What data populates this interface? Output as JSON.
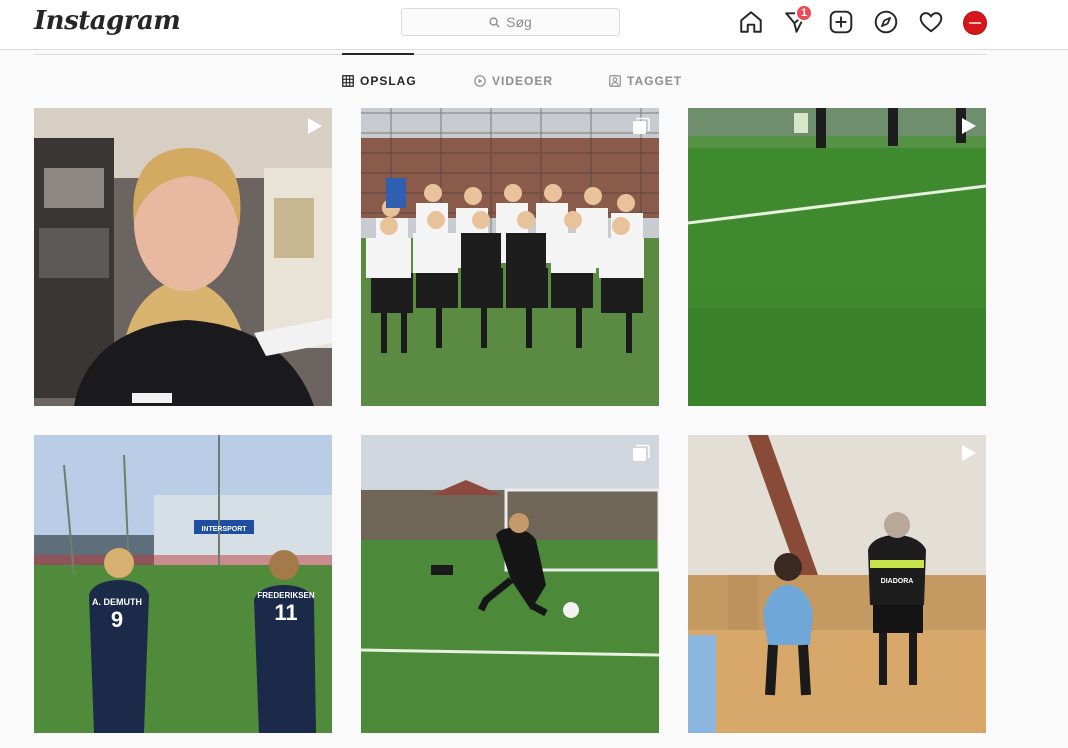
{
  "header": {
    "logo_text": "Instagram",
    "search_placeholder": "Søg",
    "notification_count": "1",
    "icons": [
      "home-icon",
      "direct-message-icon",
      "new-post-icon",
      "explore-icon",
      "activity-heart-icon",
      "profile-avatar"
    ]
  },
  "tabs": [
    {
      "label": "OPSLAG",
      "icon": "grid-icon",
      "active": true
    },
    {
      "label": "VIDEOER",
      "icon": "play-circle-icon",
      "active": false
    },
    {
      "label": "TAGGET",
      "icon": "tagged-user-icon",
      "active": false
    }
  ],
  "posts": [
    {
      "type": "video",
      "indicator": "play-icon"
    },
    {
      "type": "carousel",
      "indicator": "carousel-icon"
    },
    {
      "type": "video",
      "indicator": "play-icon"
    },
    {
      "type": "photo",
      "indicator": "",
      "text_in_image": [
        "A. DEMUTH",
        "9",
        "FREDERIKSEN",
        "11",
        "INTERSPORT"
      ]
    },
    {
      "type": "carousel",
      "indicator": "carousel-icon"
    },
    {
      "type": "video",
      "indicator": "play-icon",
      "text_in_image": [
        "DIADORA"
      ]
    }
  ],
  "colors": {
    "badge": "#ed4956",
    "border": "#dbdbdb",
    "text_muted": "#8e8e8e",
    "avatar": "#d7161c"
  }
}
